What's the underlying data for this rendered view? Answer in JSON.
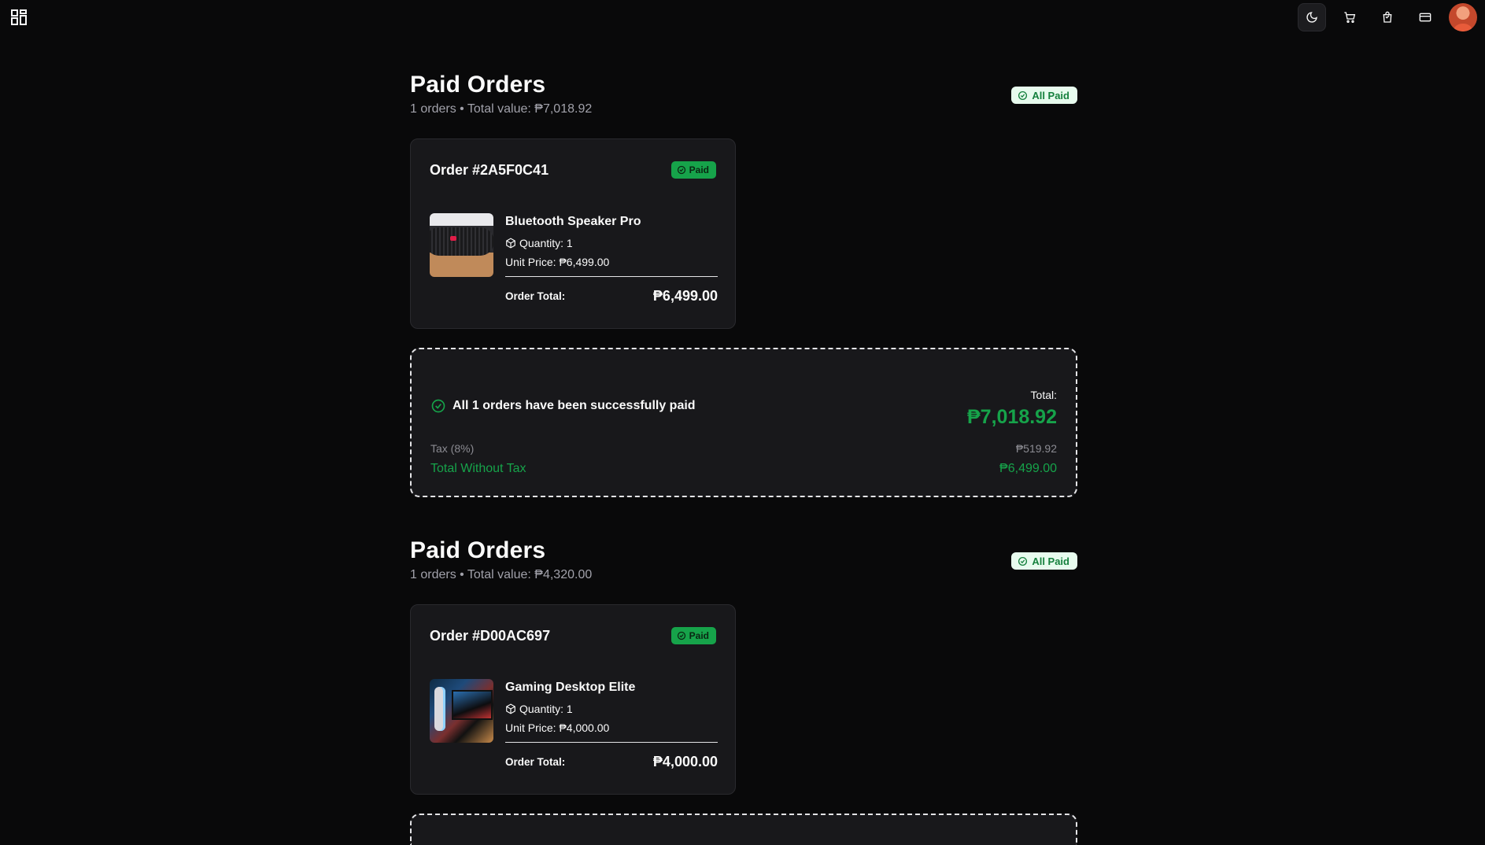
{
  "header": {
    "icons": [
      "grid-menu-icon",
      "moon-icon",
      "cart-icon",
      "bag-icon",
      "card-icon",
      "avatar"
    ],
    "colors": {
      "accent": "#16a34a",
      "background": "#09090a",
      "card": "#18181b"
    }
  },
  "sections": [
    {
      "title": "Paid Orders",
      "subtitle": "1 orders • Total value: ₱7,018.92",
      "status_badge": "All Paid",
      "order": {
        "id": "Order #2A5F0C41",
        "badge": "Paid",
        "item_name": "Bluetooth Speaker Pro",
        "quantity": "Quantity: 1",
        "unit_price": "Unit Price: ₱6,499.00",
        "total_label": "Order Total:",
        "total_value": "₱6,499.00",
        "image": "speaker-image"
      },
      "summary": {
        "message": "All 1 orders have been successfully paid",
        "total_label": "Total:",
        "total_value": "₱7,018.92",
        "tax_label": "Tax (8%)",
        "tax_value": "₱519.92",
        "net_label": "Total Without Tax",
        "net_value": "₱6,499.00"
      }
    },
    {
      "title": "Paid Orders",
      "subtitle": "1 orders • Total value: ₱4,320.00",
      "status_badge": "All Paid",
      "order": {
        "id": "Order #D00AC697",
        "badge": "Paid",
        "item_name": "Gaming Desktop Elite",
        "quantity": "Quantity: 1",
        "unit_price": "Unit Price: ₱4,000.00",
        "total_label": "Order Total:",
        "total_value": "₱4,000.00",
        "image": "desktop-image"
      }
    }
  ]
}
